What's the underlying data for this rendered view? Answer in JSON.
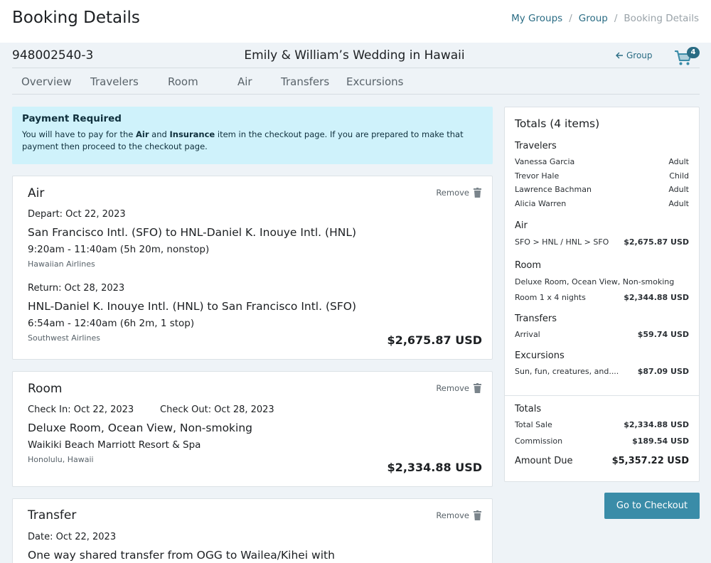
{
  "header": {
    "title": "Booking Details",
    "breadcrumb": [
      "My Groups",
      "Group",
      "Booking Details"
    ],
    "separator": "/"
  },
  "booking": {
    "id": "948002540-3",
    "group_name": "Emily & William’s Wedding in Hawaii",
    "back_label": "Group",
    "cart_count": "4"
  },
  "tabs": [
    "Overview",
    "Travelers",
    "Room",
    "Air",
    "Transfers",
    "Excursions"
  ],
  "alert": {
    "title": "Payment Required",
    "line1_a": "You will have to pay for the ",
    "line1_air": "Air",
    "line1_and": " and ",
    "line1_ins": "Insurance",
    "line1_b": " item in the checkout page. If you are prepared to make that",
    "line2": "payment then proceed to the checkout page."
  },
  "remove_label": "Remove",
  "air": {
    "title": "Air",
    "depart_label": "Depart: Oct 22, 2023",
    "depart_route": "San Francisco Intl. (SFO) to HNL-Daniel K. Inouye Intl. (HNL)",
    "depart_time": "9:20am - 11:40am (5h 20m, nonstop)",
    "depart_airline": "Hawaiian Airlines",
    "return_label": "Return: Oct 28, 2023",
    "return_route": "HNL-Daniel K. Inouye Intl. (HNL) to San Francisco Intl. (SFO)",
    "return_time": "6:54am - 12:40am (6h 2m, 1 stop)",
    "return_airline": "Southwest Airlines",
    "price": "$2,675.87 USD"
  },
  "room": {
    "title": "Room",
    "check_in": "Check In: Oct 22, 2023",
    "check_out": "Check Out: Oct 28, 2023",
    "room_type": "Deluxe Room, Ocean View, Non-smoking",
    "hotel": "Waikiki Beach Marriott Resort & Spa",
    "location": "Honolulu, Hawaii",
    "price": "$2,334.88 USD"
  },
  "transfer": {
    "title": "Transfer",
    "date": "Date: Oct 22, 2023",
    "description": "One way shared transfer from OGG to Wailea/Kihei with"
  },
  "totals": {
    "title": "Totals (4 items)",
    "travelers_head": "Travelers",
    "travelers": [
      {
        "name": "Vanessa Garcia",
        "type": "Adult"
      },
      {
        "name": "Trevor Hale",
        "type": "Child"
      },
      {
        "name": "Lawrence Bachman",
        "type": "Adult"
      },
      {
        "name": "Alicia Warren",
        "type": "Adult"
      }
    ],
    "air_head": "Air",
    "air_route": "SFO > HNL / HNL > SFO",
    "air_price": "$2,675.87 USD",
    "room_head": "Room",
    "room_type": "Deluxe Room, Ocean View, Non-smoking",
    "room_nights": "Room 1 x 4 nights",
    "room_price": "$2,344.88 USD",
    "transfers_head": "Transfers",
    "transfer_item": "Arrival",
    "transfer_price": "$59.74 USD",
    "excursions_head": "Excursions",
    "excursion_item": "Sun, fun, creatures, and....",
    "excursion_price": "$87.09 USD",
    "summary_head": "Totals",
    "total_sale_label": "Total Sale",
    "total_sale": "$2,334.88 USD",
    "commission_label": "Commission",
    "commission": "$189.54 USD",
    "amount_due_label": "Amount Due",
    "amount_due": "$5,357.22 USD"
  },
  "checkout_label": "Go to Checkout",
  "colors": {
    "accent": "#3a8ca8",
    "link": "#2a6c84",
    "alert_bg": "#cff2fb"
  }
}
